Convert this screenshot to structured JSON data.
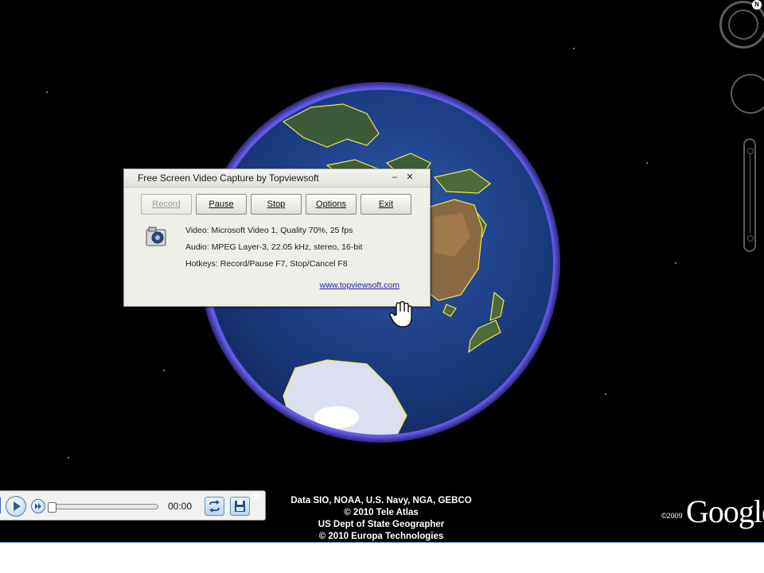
{
  "dialog": {
    "title": "Free Screen Video Capture by Topviewsoft",
    "minimize_label": "–",
    "close_label": "✕",
    "buttons": {
      "record": "Record",
      "pause": "Pause",
      "stop": "Stop",
      "options": "Options",
      "exit": "Exit"
    },
    "video_info": "Video: Microsoft Video 1, Quality 70%, 25 fps",
    "audio_info": "Audio: MPEG Layer-3, 22.05 kHz, stereo, 16-bit",
    "hotkeys_info": "Hotkeys: Record/Pause F7, Stop/Cancel F8",
    "website": "www.topviewsoft.com",
    "icon": "camera-icon"
  },
  "player": {
    "time": "00:00",
    "close_label": "✕",
    "progress": 0.0,
    "icons": [
      "play-icon",
      "fast-forward-icon",
      "repeat-icon",
      "save-icon"
    ]
  },
  "attribution": {
    "line1": "Data SIO, NOAA, U.S. Navy, NGA, GEBCO",
    "line2": "© 2010 Tele Atlas",
    "line3": "US Dept of State Geographer",
    "line4": "© 2010 Europa Technologies"
  },
  "logo": {
    "copyright": "©2009",
    "text": "Google"
  },
  "colors": {
    "atmosphere": "#6e64ff",
    "ocean": "#1d3f86",
    "borders": "#f2e84a",
    "link": "#1a1ab0"
  }
}
